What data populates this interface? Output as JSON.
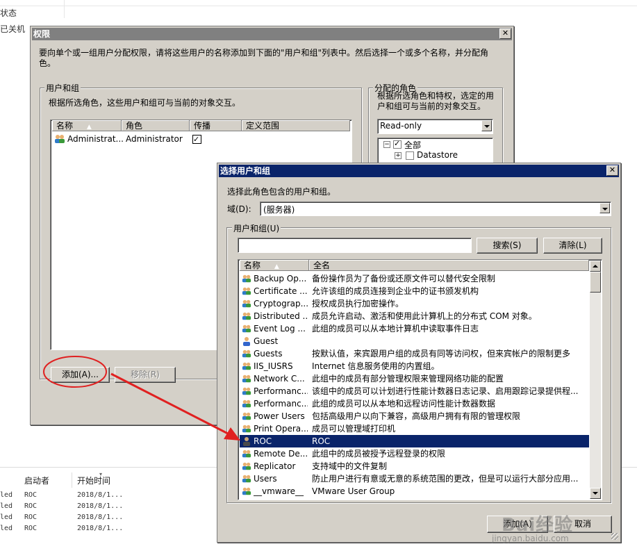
{
  "background": {
    "top_texts": [
      "状态",
      "已关机"
    ],
    "table_headers": [
      "启动者",
      "开始时间"
    ],
    "rows": [
      {
        "status": "led",
        "initiator": "ROC",
        "start": "2018/8/1..."
      },
      {
        "status": "led",
        "initiator": "ROC",
        "start": "2018/8/1..."
      },
      {
        "status": "led",
        "initiator": "ROC",
        "start": "2018/8/1..."
      },
      {
        "status": "led",
        "initiator": "ROC",
        "start": "2018/8/1..."
      }
    ]
  },
  "permission_dialog": {
    "title": "权限",
    "description": "要向单个或一组用户分配权限，请将这些用户的名称添加到下面的\"用户和组\"列表中。然后选择一个或多个名称，并分配角色。",
    "users_group": {
      "legend": "用户和组",
      "description": "根据所选角色，这些用户和组可与当前的对象交互。",
      "columns": [
        "名称",
        "角色",
        "传播",
        "定义范围"
      ],
      "rows": [
        {
          "name": "Administrat...",
          "role": "Administrator",
          "propagate": true
        }
      ],
      "add_button": "添加(A)...",
      "remove_button": "移除(R)"
    },
    "assigned_role": {
      "legend": "分配的角色",
      "description": "根据所选角色和特权，选定的用户和组可与当前的对象交互。",
      "role_select": "Read-only",
      "tree": [
        {
          "label": "全部",
          "checked": true
        },
        {
          "label": "Datastore",
          "checked": false
        }
      ]
    }
  },
  "select_dialog": {
    "title": "选择用户和组",
    "description": "选择此角色包含的用户和组。",
    "domain_label": "域(D):",
    "domain_value": "(服务器)",
    "group_legend": "用户和组(U)",
    "search_value": "",
    "search_button": "搜索(S)",
    "clear_button": "清除(L)",
    "columns": [
      "名称",
      "全名"
    ],
    "rows": [
      {
        "name": "Backup Op...",
        "full": "备份操作员为了备份或还原文件可以替代安全限制",
        "type": "group"
      },
      {
        "name": "Certificate ...",
        "full": "允许该组的成员连接到企业中的证书颁发机构",
        "type": "group"
      },
      {
        "name": "Cryptograp...",
        "full": "授权成员执行加密操作。",
        "type": "group"
      },
      {
        "name": "Distributed ...",
        "full": "成员允许启动、激活和使用此计算机上的分布式 COM 对象。",
        "type": "group"
      },
      {
        "name": "Event Log ...",
        "full": "此组的成员可以从本地计算机中读取事件日志",
        "type": "group"
      },
      {
        "name": "Guest",
        "full": "",
        "type": "user"
      },
      {
        "name": "Guests",
        "full": "按默认值，来宾跟用户组的成员有同等访问权，但来宾帐户的限制更多",
        "type": "group"
      },
      {
        "name": "IIS_IUSRS",
        "full": "Internet 信息服务使用的内置组。",
        "type": "group"
      },
      {
        "name": "Network C...",
        "full": "此组中的成员有部分管理权限来管理网络功能的配置",
        "type": "group"
      },
      {
        "name": "Performanc...",
        "full": "该组中的成员可以计划进行性能计数器日志记录、启用跟踪记录提供程...",
        "type": "group"
      },
      {
        "name": "Performanc...",
        "full": "此组的成员可以从本地和远程访问性能计数器数据",
        "type": "group"
      },
      {
        "name": "Power Users",
        "full": "包括高级用户以向下兼容，高级用户拥有有限的管理权限",
        "type": "group"
      },
      {
        "name": "Print Opera...",
        "full": "成员可以管理域打印机",
        "type": "group"
      },
      {
        "name": "ROC",
        "full": "ROC",
        "type": "user",
        "selected": true
      },
      {
        "name": "Remote De...",
        "full": "此组中的成员被授予远程登录的权限",
        "type": "group"
      },
      {
        "name": "Replicator",
        "full": "支持域中的文件复制",
        "type": "group"
      },
      {
        "name": "Users",
        "full": "防止用户进行有意或无意的系统范围的更改，但是可以运行大部分应用...",
        "type": "group"
      },
      {
        "name": "__vmware__",
        "full": "VMware User Group",
        "type": "group"
      }
    ],
    "add_button": "添加(A)",
    "cancel_button": "取消"
  },
  "watermark": {
    "brand": "Bai经验",
    "url": "jingyan.baidu.com"
  },
  "colors": {
    "selection": "#0a246a",
    "annotation": "#e02020",
    "dialog_face": "#d4d0c8"
  }
}
